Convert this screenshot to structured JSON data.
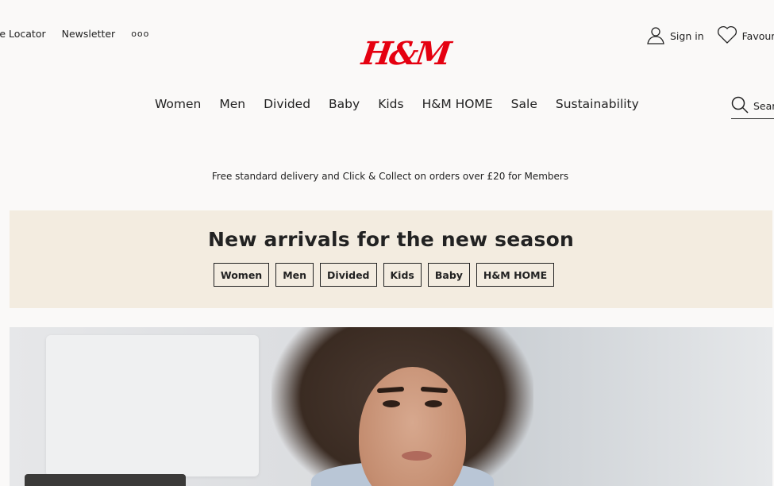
{
  "topbar": {
    "store_locator": "Store Locator",
    "newsletter": "Newsletter",
    "more": "ooo"
  },
  "brand": {
    "logo": "H&M",
    "color": "#e50010"
  },
  "account": {
    "sign_in": "Sign in",
    "favourites": "Favourites"
  },
  "nav": [
    "Women",
    "Men",
    "Divided",
    "Baby",
    "Kids",
    "H&M HOME",
    "Sale",
    "Sustainability"
  ],
  "search": {
    "placeholder": "Search products"
  },
  "promo": "Free standard delivery and Click & Collect on orders over £20 for Members",
  "banner": {
    "title": "New arrivals for the new season",
    "chips": [
      "Women",
      "Men",
      "Divided",
      "Kids",
      "Baby",
      "H&M HOME"
    ],
    "background": "#f3ece0"
  }
}
